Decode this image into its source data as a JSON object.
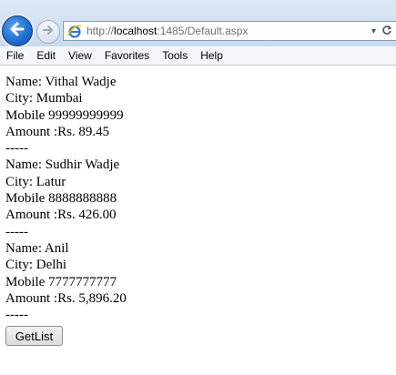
{
  "browser": {
    "url_prefix": "http://",
    "url_host": "localhost",
    "url_rest": ":1485/Default.aspx"
  },
  "menu": [
    "File",
    "Edit",
    "View",
    "Favorites",
    "Tools",
    "Help"
  ],
  "records": [
    {
      "name": "Name: Vithal Wadje",
      "city": "City: Mumbai",
      "mobile": "Mobile 99999999999",
      "amount": "Amount :Rs. 89.45",
      "separator": "-----"
    },
    {
      "name": "Name: Sudhir Wadje",
      "city": "City: Latur",
      "mobile": "Mobile 8888888888",
      "amount": "Amount :Rs. 426.00",
      "separator": "-----"
    },
    {
      "name": "Name: Anil",
      "city": "City: Delhi",
      "mobile": "Mobile 7777777777",
      "amount": "Amount :Rs. 5,896.20",
      "separator": "-----"
    }
  ],
  "button": {
    "label": "GetList"
  }
}
